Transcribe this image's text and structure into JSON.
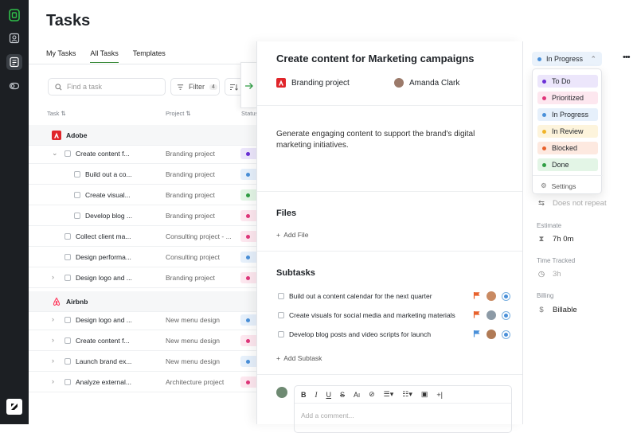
{
  "page": {
    "title": "Tasks"
  },
  "tabs": [
    {
      "label": "My Tasks"
    },
    {
      "label": "All Tasks"
    },
    {
      "label": "Templates"
    }
  ],
  "toolbar": {
    "search_placeholder": "Find a task",
    "filter_label": "Filter",
    "filter_count": "4"
  },
  "table": {
    "col_task": "Task",
    "col_project": "Project",
    "col_status": "Status"
  },
  "groups": [
    {
      "name": "Adobe"
    },
    {
      "name": "Airbnb"
    }
  ],
  "rows": [
    {
      "task": "Create content f...",
      "project": "Branding project"
    },
    {
      "task": "Build out a co...",
      "project": "Branding project"
    },
    {
      "task": "Create visual...",
      "project": "Branding project"
    },
    {
      "task": "Develop blog ...",
      "project": "Branding project"
    },
    {
      "task": "Collect client ma...",
      "project": "Consulting project - ..."
    },
    {
      "task": "Design performa...",
      "project": "Consulting project"
    },
    {
      "task": "Design logo and ...",
      "project": "Branding project"
    },
    {
      "task": "Design logo and ...",
      "project": "New menu design"
    },
    {
      "task": "Create content f...",
      "project": "New menu design"
    },
    {
      "task": "Launch brand ex...",
      "project": "New menu design"
    },
    {
      "task": "Analyze external...",
      "project": "Architecture project"
    }
  ],
  "colors": {
    "todo": "#6b2fd6",
    "prioritized": "#e0357a",
    "inprogress": "#4a90d9",
    "inreview": "#f0b429",
    "blocked": "#e8612c",
    "done": "#2f9e44"
  },
  "panel": {
    "title": "Create content for Marketing campaigns",
    "project": "Branding project",
    "assignee": "Amanda Clark",
    "description": "Generate engaging content to support the brand's digital marketing initiatives.",
    "files_heading": "Files",
    "add_file": "Add File",
    "subtasks_heading": "Subtasks",
    "subtasks": [
      {
        "title": "Build out a content calendar for the next quarter"
      },
      {
        "title": "Create visuals for social media and marketing materials"
      },
      {
        "title": "Develop blog posts and video scripts for launch"
      }
    ],
    "add_subtask": "Add Subtask",
    "comment_placeholder": "Add a comment..."
  },
  "side": {
    "status": "In Progress",
    "repeat": "Does not repeat",
    "estimate_label": "Estimate",
    "estimate": "7h 0m",
    "time_label": "Time Tracked",
    "time": "3h",
    "billing_label": "Billing",
    "billing": "Billable"
  },
  "status_menu": {
    "options": [
      {
        "label": "To Do"
      },
      {
        "label": "Prioritized"
      },
      {
        "label": "In Progress"
      },
      {
        "label": "In Review"
      },
      {
        "label": "Blocked"
      },
      {
        "label": "Done"
      }
    ],
    "settings": "Settings"
  }
}
